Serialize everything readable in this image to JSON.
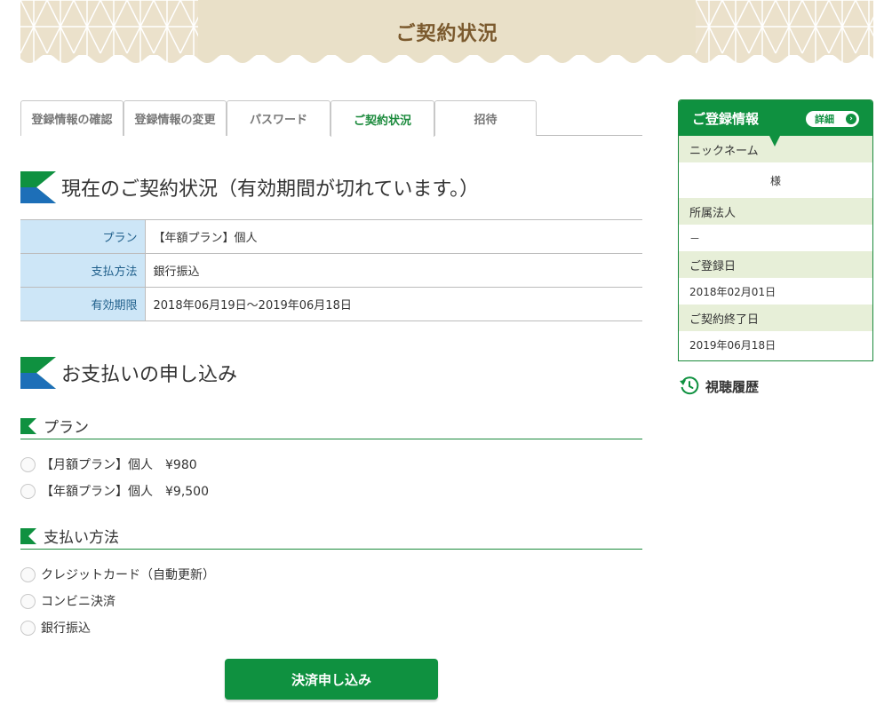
{
  "banner": {
    "title": "ご契約状況"
  },
  "tabs": [
    {
      "label": "登録情報の確認"
    },
    {
      "label": "登録情報の変更"
    },
    {
      "label": "パスワード"
    },
    {
      "label": "ご契約状況"
    },
    {
      "label": "招待"
    }
  ],
  "status": {
    "heading": "現在のご契約状況（有効期間が切れています。）",
    "rows": [
      {
        "key": "プラン",
        "value": "【年額プラン】個人"
      },
      {
        "key": "支払方法",
        "value": "銀行振込"
      },
      {
        "key": "有効期限",
        "value": "2018年06月19日～2019年06月18日"
      }
    ]
  },
  "apply": {
    "heading": "お支払いの申し込み",
    "plan_heading": "プラン",
    "plans": [
      {
        "label": "【月額プラン】個人　¥980"
      },
      {
        "label": "【年額プラン】個人　¥9,500"
      }
    ],
    "method_heading": "支払い方法",
    "methods": [
      {
        "label": "クレジットカード（自動更新）"
      },
      {
        "label": "コンビニ決済"
      },
      {
        "label": "銀行振込"
      }
    ],
    "submit_label": "決済申し込み"
  },
  "sidebar": {
    "title": "ご登録情報",
    "detail_label": "詳細",
    "nickname_label": "ニックネーム",
    "nickname_value": "様",
    "company_label": "所属法人",
    "company_value": "－",
    "registered_label": "ご登録日",
    "registered_value": "2018年02月01日",
    "contract_end_label": "ご契約終了日",
    "contract_end_value": "2019年06月18日"
  },
  "history": {
    "label": "視聴履歴"
  },
  "colors": {
    "brand_green": "#0f9140",
    "flag_blue": "#1d6fb8",
    "table_key_bg": "#cde6f7",
    "side_label_bg": "#e7efd8",
    "banner_bg": "#ebe1cb",
    "banner_title": "#7b5a2e"
  },
  "icons": {
    "section_flag": "flag-icon",
    "detail_arrow": "chevron-right-icon",
    "history": "history-clock-icon"
  }
}
